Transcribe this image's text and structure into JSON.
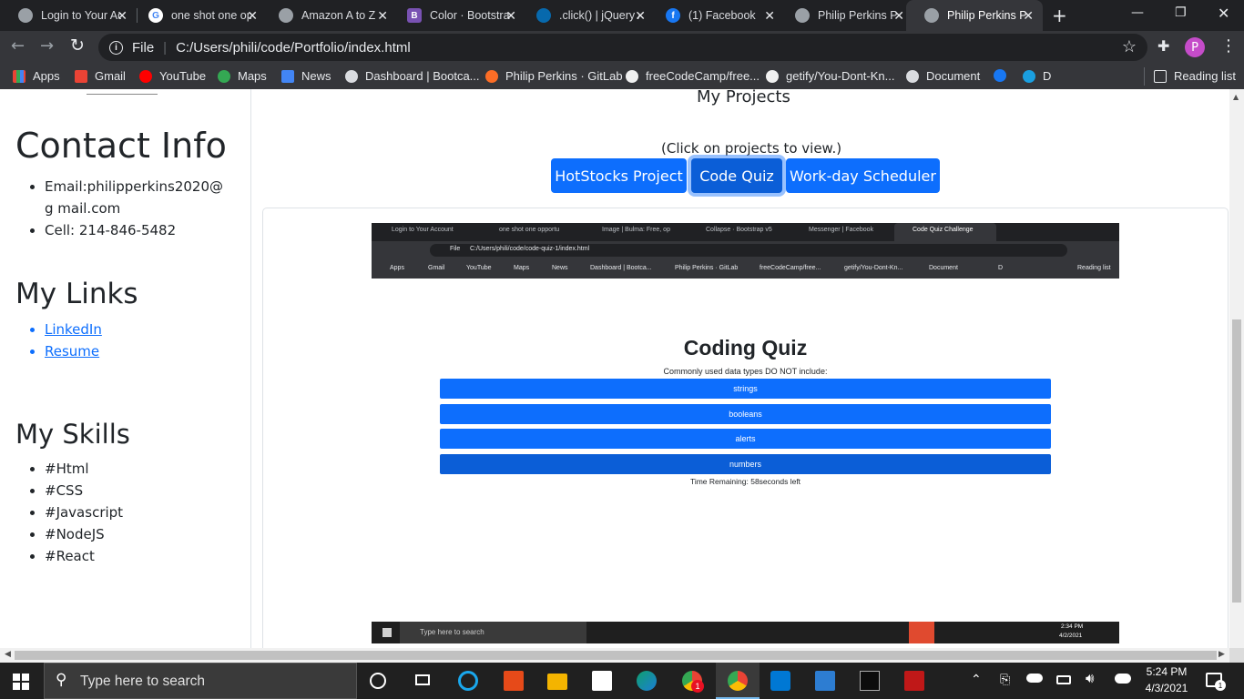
{
  "browser": {
    "tabs": [
      {
        "title": "Login to Your Account",
        "favicon": "globe-icon"
      },
      {
        "title": "one shot one opportunity",
        "favicon": "google-icon"
      },
      {
        "title": "Amazon A to Z",
        "favicon": "globe-icon"
      },
      {
        "title": "Color · Bootstrap",
        "favicon": "bootstrap-icon"
      },
      {
        "title": ".click() | jQuery API",
        "favicon": "jquery-icon"
      },
      {
        "title": "(1) Facebook",
        "favicon": "facebook-icon"
      },
      {
        "title": "Philip Perkins Portfolio",
        "favicon": "globe-icon"
      },
      {
        "title": "Philip Perkins Portfolio",
        "favicon": "globe-icon",
        "active": true
      }
    ],
    "address": {
      "scheme_label": "File",
      "url": "C:/Users/phili/code/Portfolio/index.html"
    },
    "profile_initial": "P",
    "bookmarks": [
      {
        "label": "Apps",
        "icon": "apps-icon"
      },
      {
        "label": "Gmail",
        "icon": "gmail-icon"
      },
      {
        "label": "YouTube",
        "icon": "youtube-icon"
      },
      {
        "label": "Maps",
        "icon": "maps-icon"
      },
      {
        "label": "News",
        "icon": "news-icon"
      },
      {
        "label": "Dashboard | Bootca...",
        "icon": "globe-icon"
      },
      {
        "label": "Philip Perkins · GitLab",
        "icon": "gitlab-icon"
      },
      {
        "label": "freeCodeCamp/free...",
        "icon": "github-icon"
      },
      {
        "label": "getify/You-Dont-Kn...",
        "icon": "github-icon"
      },
      {
        "label": "Document",
        "icon": "globe-icon"
      },
      {
        "label": "",
        "icon": "facebook-icon"
      },
      {
        "label": "D",
        "icon": "cloud-icon"
      }
    ],
    "reading_list": "Reading list"
  },
  "sidebar": {
    "contact_title": "Contact Info",
    "contact_items": [
      "Email:philipperkins2020@g mail.com",
      "Cell: 214-846-5482"
    ],
    "links_title": "My Links",
    "links": [
      "LinkedIn",
      "Resume"
    ],
    "skills_title": "My Skills",
    "skills": [
      "#Html",
      "#CSS",
      "#Javascript",
      "#NodeJS",
      "#React"
    ]
  },
  "main": {
    "section_title": "My Projects",
    "hint": "(Click on projects to view.)",
    "project_buttons": [
      "HotStocks Project",
      "Code Quiz",
      "Work-day Scheduler"
    ],
    "active_project": "Code Quiz"
  },
  "preview": {
    "tabs": [
      "Login to Your Account",
      "one shot one opportu",
      "Image | Bulma: Free, op",
      "Collapse · Bootstrap v5",
      "Messenger | Facebook",
      "Code Quiz Challenge"
    ],
    "address": "C:/Users/phili/code/code-quiz-1/index.html",
    "address_scheme": "File",
    "bookmarks": [
      "Apps",
      "Gmail",
      "YouTube",
      "Maps",
      "News",
      "Dashboard | Bootca...",
      "Philip Perkins · GitLab",
      "freeCodeCamp/free...",
      "getify/You-Dont-Kn...",
      "Document",
      "D",
      "Reading list"
    ],
    "quiz_title": "Coding Quiz",
    "question": "Commonly used data types DO NOT include:",
    "answers": [
      "strings",
      "booleans",
      "alerts",
      "numbers"
    ],
    "timer": "Time Remaining: 58seconds left",
    "taskbar_search": "Type here to search",
    "taskbar_time": "2:34 PM",
    "taskbar_date": "4/2/2021"
  },
  "taskbar": {
    "search_placeholder": "Type here to search",
    "time": "5:24 PM",
    "date": "4/3/2021",
    "notification_count": "1",
    "chrome_badge": "1"
  },
  "colors": {
    "primary": "#0d6efd",
    "link": "#0d6efd",
    "tab_bar": "#202124",
    "toolbar": "#35363a",
    "taskbar": "#202020"
  }
}
